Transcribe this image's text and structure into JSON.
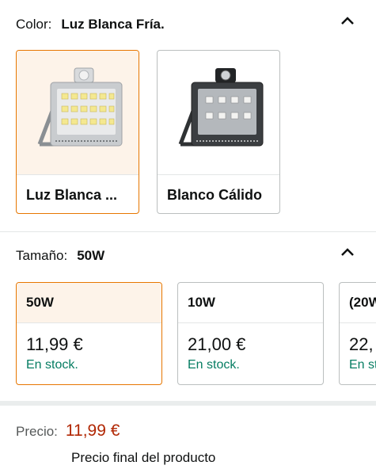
{
  "color": {
    "label": "Color:",
    "selected": "Luz Blanca Fría.",
    "options": [
      {
        "name": "Luz Blanca ...",
        "icon": "floodlight-white-icon"
      },
      {
        "name": "Blanco Cálido",
        "icon": "floodlight-dark-icon"
      }
    ]
  },
  "size": {
    "label": "Tamaño:",
    "selected": "50W",
    "options": [
      {
        "name": "50W",
        "price": "11,99 €",
        "stock": "En stock."
      },
      {
        "name": "10W",
        "price": "21,00 €",
        "stock": "En stock."
      },
      {
        "name": "(20W",
        "price": "22,",
        "stock": "En st"
      }
    ]
  },
  "price": {
    "label": "Precio:",
    "value": "11,99 €",
    "note": "Precio final del producto"
  },
  "colors": {
    "accent": "#e77600",
    "price": "#b12704",
    "stock": "#067d62"
  }
}
